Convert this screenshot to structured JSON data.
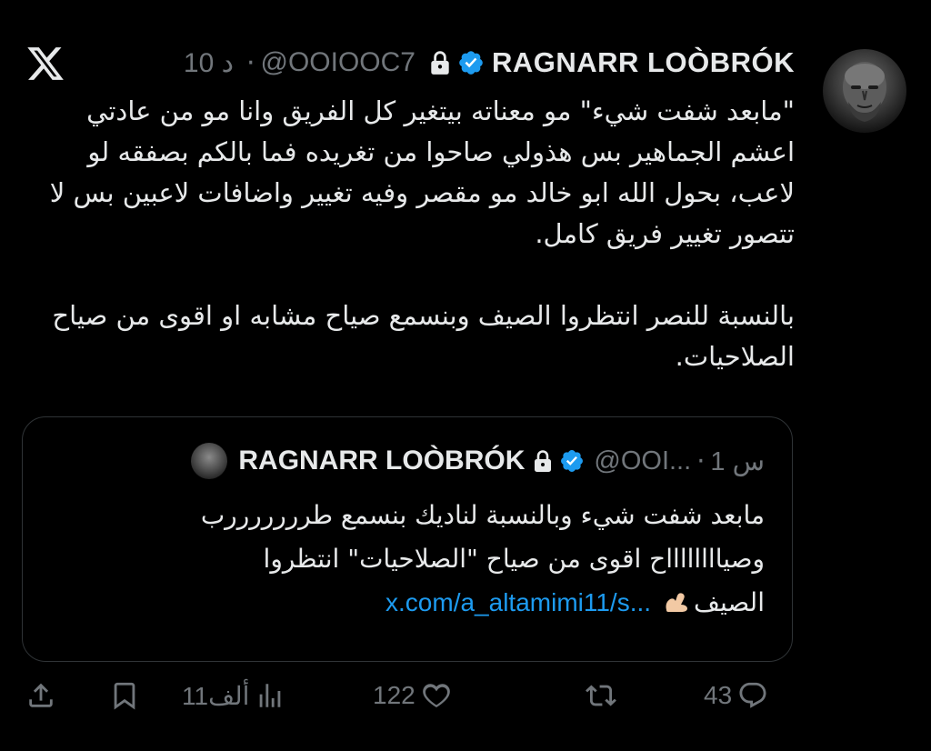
{
  "post": {
    "author_name": "RAGNARR LOÒBRÓK",
    "handle": "@OOIOOC7",
    "separator": "·",
    "time": "10 د",
    "paragraphs": [
      "\"مابعد شفت شيء\" مو معناته بيتغير كل الفريق وانا مو من عادتي اعشم الجماهير بس هذولي صاحوا من تغريده فما بالكم بصفقه لو لاعب، بحول الله ابو خالد مو مقصر وفيه تغيير واضافات لاعبين بس لا تتصور تغيير فريق كامل.",
      "بالنسبة للنصر انتظروا الصيف وبنسمع صياح مشابه او اقوى من صياح الصلاحيات."
    ]
  },
  "quote": {
    "author_name": "RAGNARR LOÒBRÓK",
    "handle": "@OOI...",
    "separator": "·",
    "time": "1 س",
    "text_line1": "مابعد شفت شيء وبالنسبة لناديك بنسمع طرررررررب",
    "text_line2": "وصيااااااااح اقوى من صياح \"الصلاحيات\" انتظروا",
    "text_line3_word": "الصيف",
    "link": "x.com/a_altamimi11/s..."
  },
  "actions": {
    "replies": "43",
    "reposts": "",
    "likes": "122",
    "views": "11ألف"
  },
  "icons": {
    "logo": "x-logo-icon",
    "lock": "lock-icon",
    "verified": "verified-badge-icon",
    "reply": "reply-icon",
    "repost": "repost-icon",
    "like": "heart-icon",
    "views": "views-chart-icon",
    "bookmark": "bookmark-icon",
    "share": "share-icon",
    "emoji": "flexed-biceps-emoji"
  },
  "colors": {
    "background": "#000000",
    "text": "#e7e9ea",
    "muted": "#71767b",
    "link": "#1d9bf0",
    "verified": "#1d9bf0",
    "border": "#2f3336"
  }
}
